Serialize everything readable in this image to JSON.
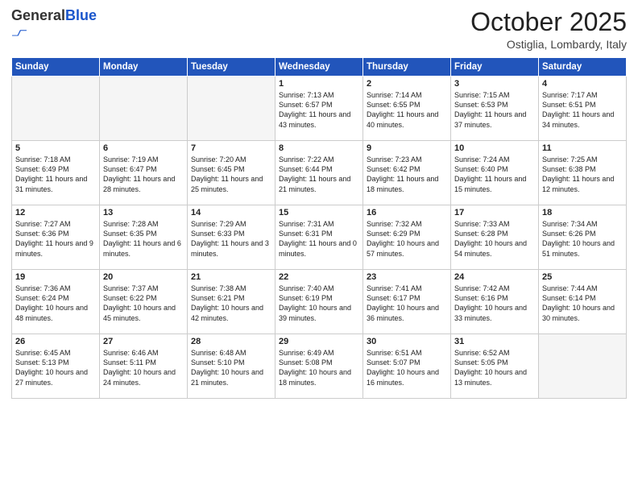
{
  "header": {
    "logo_general": "General",
    "logo_blue": "Blue",
    "month_title": "October 2025",
    "location": "Ostiglia, Lombardy, Italy"
  },
  "days_of_week": [
    "Sunday",
    "Monday",
    "Tuesday",
    "Wednesday",
    "Thursday",
    "Friday",
    "Saturday"
  ],
  "weeks": [
    [
      {
        "day": "",
        "empty": true
      },
      {
        "day": "",
        "empty": true
      },
      {
        "day": "",
        "empty": true
      },
      {
        "day": "1",
        "sunrise": "7:13 AM",
        "sunset": "6:57 PM",
        "daylight": "11 hours and 43 minutes."
      },
      {
        "day": "2",
        "sunrise": "7:14 AM",
        "sunset": "6:55 PM",
        "daylight": "11 hours and 40 minutes."
      },
      {
        "day": "3",
        "sunrise": "7:15 AM",
        "sunset": "6:53 PM",
        "daylight": "11 hours and 37 minutes."
      },
      {
        "day": "4",
        "sunrise": "7:17 AM",
        "sunset": "6:51 PM",
        "daylight": "11 hours and 34 minutes."
      }
    ],
    [
      {
        "day": "5",
        "sunrise": "7:18 AM",
        "sunset": "6:49 PM",
        "daylight": "11 hours and 31 minutes."
      },
      {
        "day": "6",
        "sunrise": "7:19 AM",
        "sunset": "6:47 PM",
        "daylight": "11 hours and 28 minutes."
      },
      {
        "day": "7",
        "sunrise": "7:20 AM",
        "sunset": "6:45 PM",
        "daylight": "11 hours and 25 minutes."
      },
      {
        "day": "8",
        "sunrise": "7:22 AM",
        "sunset": "6:44 PM",
        "daylight": "11 hours and 21 minutes."
      },
      {
        "day": "9",
        "sunrise": "7:23 AM",
        "sunset": "6:42 PM",
        "daylight": "11 hours and 18 minutes."
      },
      {
        "day": "10",
        "sunrise": "7:24 AM",
        "sunset": "6:40 PM",
        "daylight": "11 hours and 15 minutes."
      },
      {
        "day": "11",
        "sunrise": "7:25 AM",
        "sunset": "6:38 PM",
        "daylight": "11 hours and 12 minutes."
      }
    ],
    [
      {
        "day": "12",
        "sunrise": "7:27 AM",
        "sunset": "6:36 PM",
        "daylight": "11 hours and 9 minutes."
      },
      {
        "day": "13",
        "sunrise": "7:28 AM",
        "sunset": "6:35 PM",
        "daylight": "11 hours and 6 minutes."
      },
      {
        "day": "14",
        "sunrise": "7:29 AM",
        "sunset": "6:33 PM",
        "daylight": "11 hours and 3 minutes."
      },
      {
        "day": "15",
        "sunrise": "7:31 AM",
        "sunset": "6:31 PM",
        "daylight": "11 hours and 0 minutes."
      },
      {
        "day": "16",
        "sunrise": "7:32 AM",
        "sunset": "6:29 PM",
        "daylight": "10 hours and 57 minutes."
      },
      {
        "day": "17",
        "sunrise": "7:33 AM",
        "sunset": "6:28 PM",
        "daylight": "10 hours and 54 minutes."
      },
      {
        "day": "18",
        "sunrise": "7:34 AM",
        "sunset": "6:26 PM",
        "daylight": "10 hours and 51 minutes."
      }
    ],
    [
      {
        "day": "19",
        "sunrise": "7:36 AM",
        "sunset": "6:24 PM",
        "daylight": "10 hours and 48 minutes."
      },
      {
        "day": "20",
        "sunrise": "7:37 AM",
        "sunset": "6:22 PM",
        "daylight": "10 hours and 45 minutes."
      },
      {
        "day": "21",
        "sunrise": "7:38 AM",
        "sunset": "6:21 PM",
        "daylight": "10 hours and 42 minutes."
      },
      {
        "day": "22",
        "sunrise": "7:40 AM",
        "sunset": "6:19 PM",
        "daylight": "10 hours and 39 minutes."
      },
      {
        "day": "23",
        "sunrise": "7:41 AM",
        "sunset": "6:17 PM",
        "daylight": "10 hours and 36 minutes."
      },
      {
        "day": "24",
        "sunrise": "7:42 AM",
        "sunset": "6:16 PM",
        "daylight": "10 hours and 33 minutes."
      },
      {
        "day": "25",
        "sunrise": "7:44 AM",
        "sunset": "6:14 PM",
        "daylight": "10 hours and 30 minutes."
      }
    ],
    [
      {
        "day": "26",
        "sunrise": "6:45 AM",
        "sunset": "5:13 PM",
        "daylight": "10 hours and 27 minutes."
      },
      {
        "day": "27",
        "sunrise": "6:46 AM",
        "sunset": "5:11 PM",
        "daylight": "10 hours and 24 minutes."
      },
      {
        "day": "28",
        "sunrise": "6:48 AM",
        "sunset": "5:10 PM",
        "daylight": "10 hours and 21 minutes."
      },
      {
        "day": "29",
        "sunrise": "6:49 AM",
        "sunset": "5:08 PM",
        "daylight": "10 hours and 18 minutes."
      },
      {
        "day": "30",
        "sunrise": "6:51 AM",
        "sunset": "5:07 PM",
        "daylight": "10 hours and 16 minutes."
      },
      {
        "day": "31",
        "sunrise": "6:52 AM",
        "sunset": "5:05 PM",
        "daylight": "10 hours and 13 minutes."
      },
      {
        "day": "",
        "empty": true
      }
    ]
  ]
}
